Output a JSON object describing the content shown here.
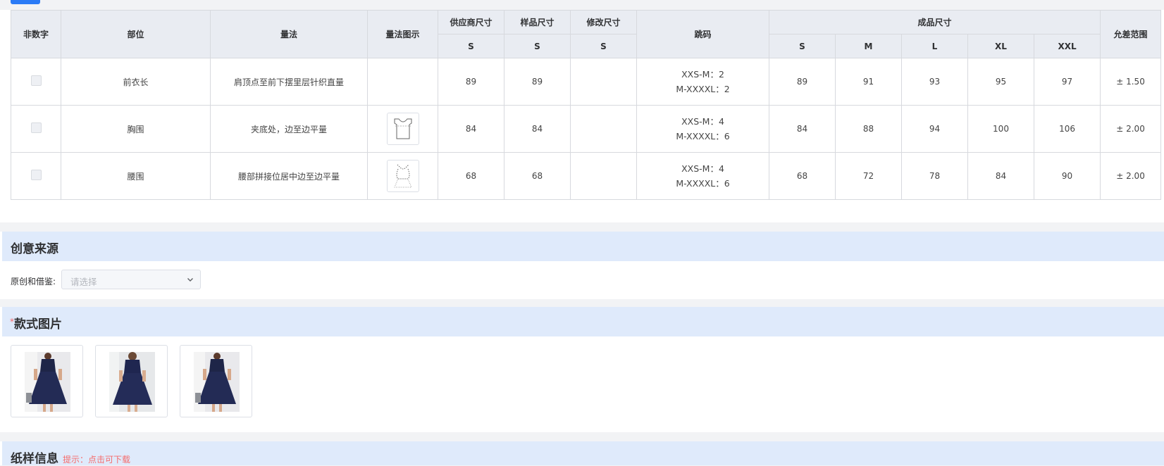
{
  "size_table": {
    "headers": {
      "non_numeric": "非数字",
      "part": "部位",
      "method": "量法",
      "method_diagram": "量法图示",
      "supplier_size": "供应商尺寸",
      "sample_size": "样品尺寸",
      "modified_size": "修改尺寸",
      "jump": "跳码",
      "finished_size": "成品尺寸",
      "tolerance": "允差范围",
      "sub_s": "S",
      "sizes": [
        "S",
        "M",
        "L",
        "XL",
        "XXL"
      ]
    },
    "rows": [
      {
        "part": "前衣长",
        "method": "肩顶点至前下摆里层针织直量",
        "diagram": "",
        "supplier": "89",
        "sample": "89",
        "modified": "",
        "jump1": "XXS-M：2",
        "jump2": "M-XXXXL：2",
        "finished": [
          "89",
          "91",
          "93",
          "95",
          "97"
        ],
        "tolerance": "± 1.50"
      },
      {
        "part": "胸围",
        "method": "夹底处，边至边平量",
        "diagram": "chest-diagram",
        "supplier": "84",
        "sample": "84",
        "modified": "",
        "jump1": "XXS-M：4",
        "jump2": "M-XXXXL：6",
        "finished": [
          "84",
          "88",
          "94",
          "100",
          "106"
        ],
        "tolerance": "± 2.00"
      },
      {
        "part": "腰围",
        "method": "腰部拼接位居中边至边平量",
        "diagram": "waist-diagram",
        "supplier": "68",
        "sample": "68",
        "modified": "",
        "jump1": "XXS-M：4",
        "jump2": "M-XXXXL：6",
        "finished": [
          "68",
          "72",
          "78",
          "84",
          "90"
        ],
        "tolerance": "± 2.00"
      }
    ]
  },
  "creative_source": {
    "title": "创意来源",
    "field_label": "原创和借鉴:",
    "placeholder": "请选择"
  },
  "style_images": {
    "required_mark": "*",
    "title": "款式图片",
    "images": [
      "dress-front-photo",
      "dress-back-photo",
      "dress-front-photo-2"
    ]
  },
  "pattern_info": {
    "title": "纸样信息",
    "hint": "提示：点击可下载"
  },
  "colors": {
    "section_header_bg": "#dfeafb",
    "table_header_bg": "#e9ecf2",
    "accent_blue": "#2b7bf6",
    "hint_red": "#f56c6c"
  }
}
